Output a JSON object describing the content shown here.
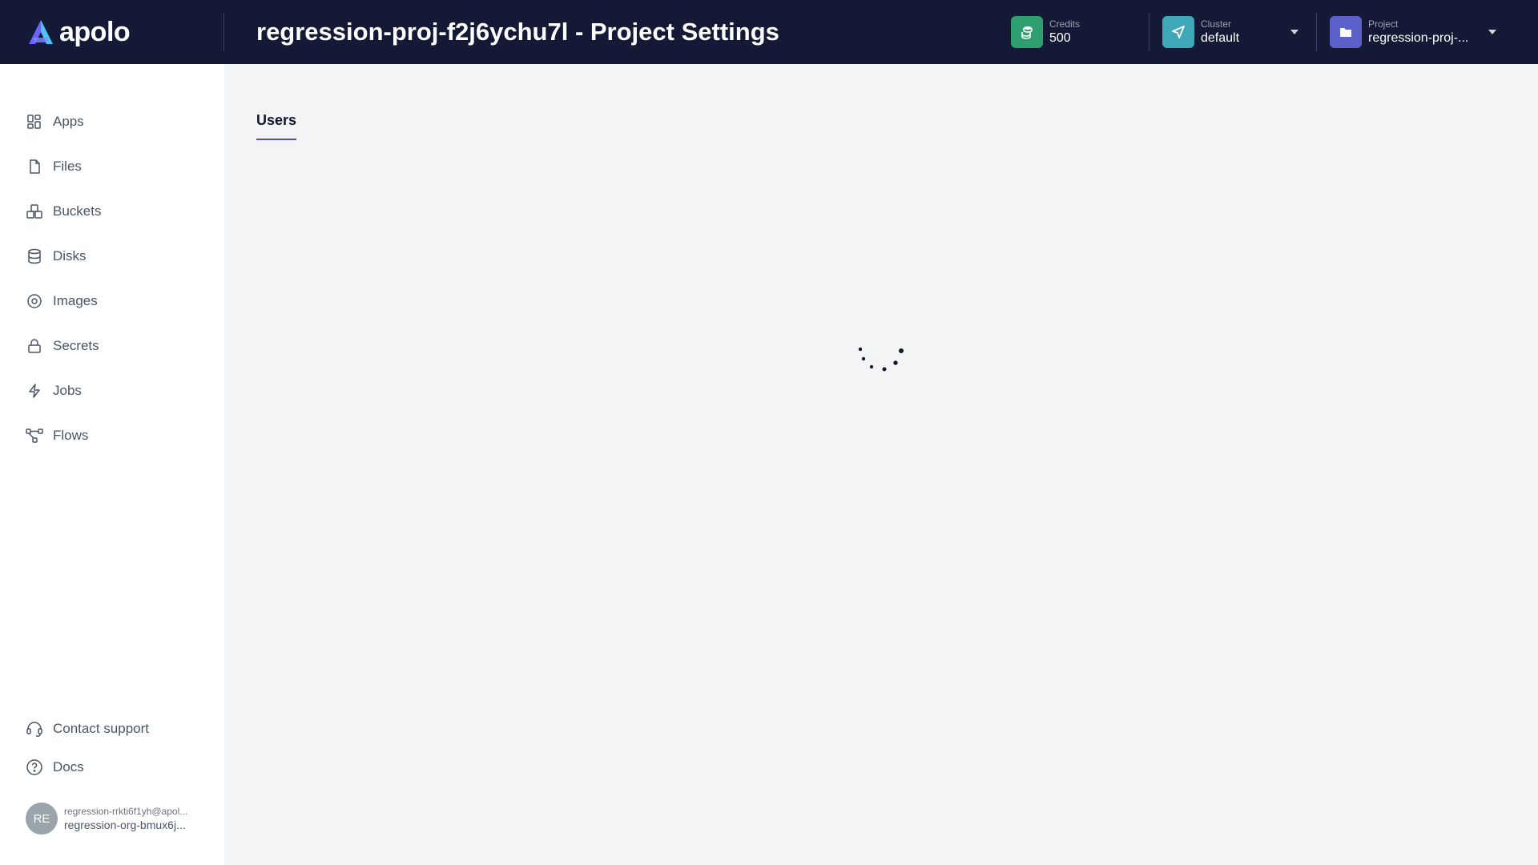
{
  "app": {
    "logo_text": "apolo",
    "page_title": "regression-proj-f2j6ychu7l - Project Settings"
  },
  "header": {
    "credits": {
      "label": "Credits",
      "value": "500",
      "icon": "coins-icon",
      "color": "#2e9e6e"
    },
    "cluster": {
      "label": "Cluster",
      "value": "default",
      "icon": "navigation-arrow-icon",
      "color": "#3fa7b5"
    },
    "project": {
      "label": "Project",
      "value": "regression-proj-...",
      "icon": "folder-icon",
      "color": "#5b5fc7"
    }
  },
  "sidebar": {
    "items": [
      {
        "label": "Apps",
        "icon": "apps-grid-icon"
      },
      {
        "label": "Files",
        "icon": "file-icon"
      },
      {
        "label": "Buckets",
        "icon": "buckets-icon"
      },
      {
        "label": "Disks",
        "icon": "database-icon"
      },
      {
        "label": "Images",
        "icon": "disc-icon"
      },
      {
        "label": "Secrets",
        "icon": "lock-icon"
      },
      {
        "label": "Jobs",
        "icon": "lightning-icon"
      },
      {
        "label": "Flows",
        "icon": "flow-icon"
      }
    ],
    "bottom": [
      {
        "label": "Contact support",
        "icon": "headset-icon"
      },
      {
        "label": "Docs",
        "icon": "help-circle-icon"
      }
    ],
    "user": {
      "initials": "RE",
      "email": "regression-rrkti6f1yh@apol...",
      "org": "regression-org-bmux6j..."
    }
  },
  "main": {
    "tabs": [
      {
        "label": "Users",
        "active": true
      }
    ]
  },
  "colors": {
    "header_bg": "#141a36",
    "accent": "#4f46e5"
  }
}
